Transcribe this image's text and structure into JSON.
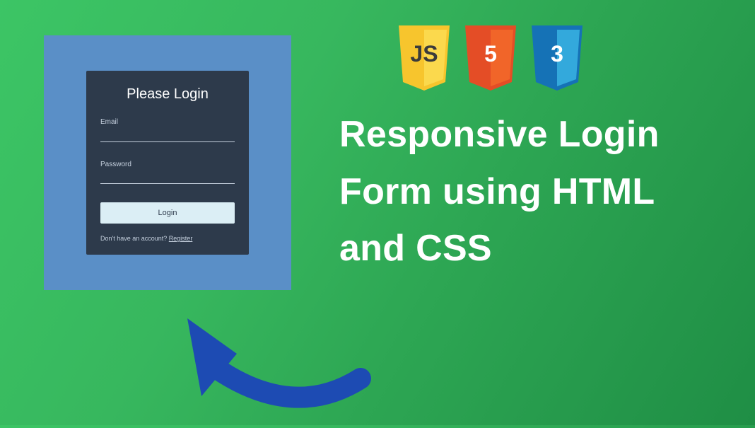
{
  "login": {
    "title": "Please Login",
    "email_label": "Email",
    "password_label": "Password",
    "button_label": "Login",
    "footer_question": "Don't have an account? ",
    "footer_link": "Register"
  },
  "badges": {
    "js": "JS",
    "html": "5",
    "css": "3"
  },
  "headline": {
    "line1": "Responsive Login",
    "line2": "Form using HTML",
    "line3": "and CSS"
  },
  "colors": {
    "js_shield": "#f7c52d",
    "html_shield": "#e44d26",
    "css_shield": "#1572b6",
    "arrow": "#1d4bb3",
    "panel": "#5a8fc7",
    "card": "#2d3a4b"
  }
}
